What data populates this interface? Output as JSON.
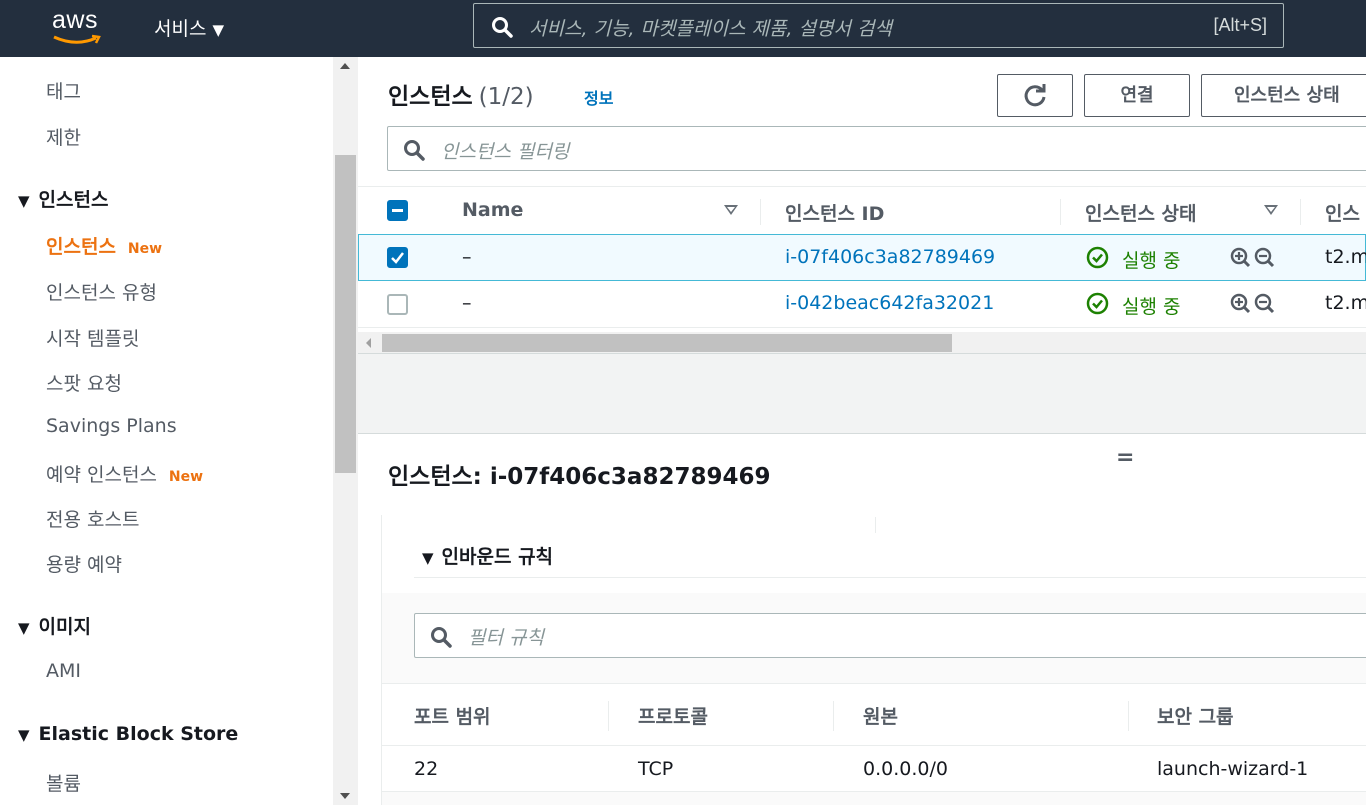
{
  "topnav": {
    "logo": "aws",
    "services_label": "서비스",
    "search_placeholder": "서비스, 기능, 마켓플레이스 제품, 설명서 검색",
    "search_shortcut": "[Alt+S]"
  },
  "sidebar": {
    "items": [
      {
        "label": "태그"
      },
      {
        "label": "제한"
      }
    ],
    "section_instances": "인스턴스",
    "instance_items": [
      {
        "label": "인스턴스",
        "badge": "New",
        "active": true
      },
      {
        "label": "인스턴스 유형"
      },
      {
        "label": "시작 템플릿"
      },
      {
        "label": "스팟 요청"
      },
      {
        "label": "Savings Plans"
      },
      {
        "label": "예약 인스턴스",
        "badge": "New"
      },
      {
        "label": "전용 호스트"
      },
      {
        "label": "용량 예약"
      }
    ],
    "section_images": "이미지",
    "image_items": [
      {
        "label": "AMI"
      }
    ],
    "section_ebs": "Elastic Block Store",
    "ebs_items": [
      {
        "label": "볼륨"
      }
    ]
  },
  "main": {
    "title": "인스턴스",
    "count": "(1/2)",
    "info_link": "정보",
    "connect_button": "연결",
    "state_button": "인스턴스 상태",
    "filter_placeholder": "인스턴스 필터링",
    "columns": {
      "name": "Name",
      "instance_id": "인스턴스 ID",
      "state": "인스턴스 상태",
      "type": "인스"
    },
    "rows": [
      {
        "name": "–",
        "instance_id": "i-07f406c3a82789469",
        "state": "실행 중",
        "type": "t2.m",
        "selected": true
      },
      {
        "name": "–",
        "instance_id": "i-042beac642fa32021",
        "state": "실행 중",
        "type": "t2.m",
        "selected": false
      }
    ]
  },
  "detail": {
    "title": "인스턴스: i-07f406c3a82789469",
    "inbound_title": "인바운드 규칙",
    "filter_placeholder": "필터 규칙",
    "columns": {
      "port_range": "포트 범위",
      "protocol": "프로토콜",
      "source": "원본",
      "security_group": "보안 그룹"
    },
    "rules": [
      {
        "port_range": "22",
        "protocol": "TCP",
        "source": "0.0.0.0/0",
        "security_group": "launch-wizard-1"
      }
    ]
  },
  "colors": {
    "nav_bg": "#232f3e",
    "accent_orange": "#ec7211",
    "link_blue": "#0073bb",
    "status_green": "#1d8102"
  }
}
